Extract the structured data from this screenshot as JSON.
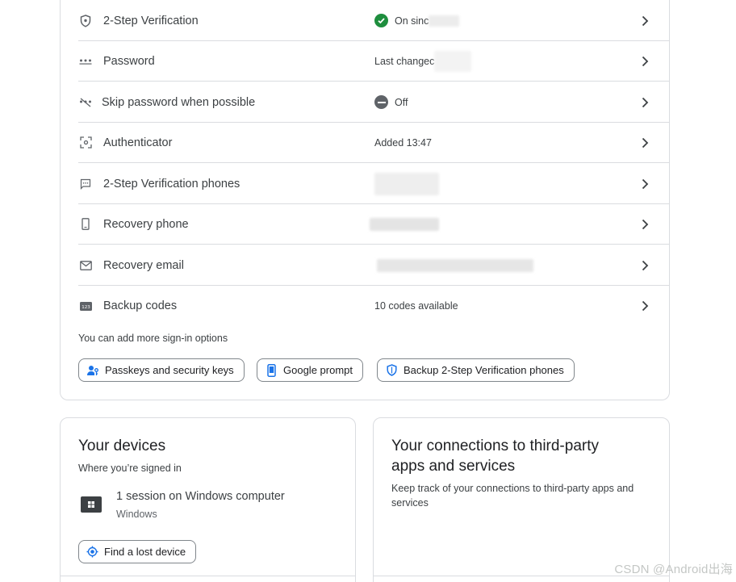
{
  "signin_rows": [
    {
      "label": "2-Step Verification",
      "value": "On sinc",
      "status": "on",
      "icon": "shield-icon"
    },
    {
      "label": "Password",
      "value": "Last changec",
      "icon": "password-dots-icon"
    },
    {
      "label": "Skip password when possible",
      "value": "Off",
      "status": "off",
      "icon": "skip-password-icon"
    },
    {
      "label": "Authenticator",
      "value": "Added 13:47",
      "icon": "authenticator-icon"
    },
    {
      "label": "2-Step Verification phones",
      "value": "",
      "icon": "message-icon"
    },
    {
      "label": "Recovery phone",
      "value": "",
      "icon": "phone-icon"
    },
    {
      "label": "Recovery email",
      "value": "",
      "icon": "mail-icon"
    },
    {
      "label": "Backup codes",
      "value": "10 codes available",
      "icon": "backup-codes-icon"
    }
  ],
  "add_options": {
    "text": "You can add more sign-in options",
    "buttons": [
      {
        "label": "Passkeys and security keys",
        "icon": "person-key-icon"
      },
      {
        "label": "Google prompt",
        "icon": "phone-prompt-icon"
      },
      {
        "label": "Backup 2-Step Verification phones",
        "icon": "shield-icon"
      }
    ]
  },
  "devices_card": {
    "title": "Your devices",
    "subtitle": "Where you’re signed in",
    "session": "1 session on Windows computer",
    "os": "Windows",
    "find_button": "Find a lost device"
  },
  "connections_card": {
    "title_line1": "Your connections to third-party",
    "title_line2": "apps and services",
    "subtitle_line1": "Keep track of your connections to third-party apps and",
    "subtitle_line2": "services"
  },
  "watermark": "CSDN @Android出海",
  "colors": {
    "accent": "#1a73e8",
    "success": "#1e8e3e",
    "border": "#dadce0"
  }
}
